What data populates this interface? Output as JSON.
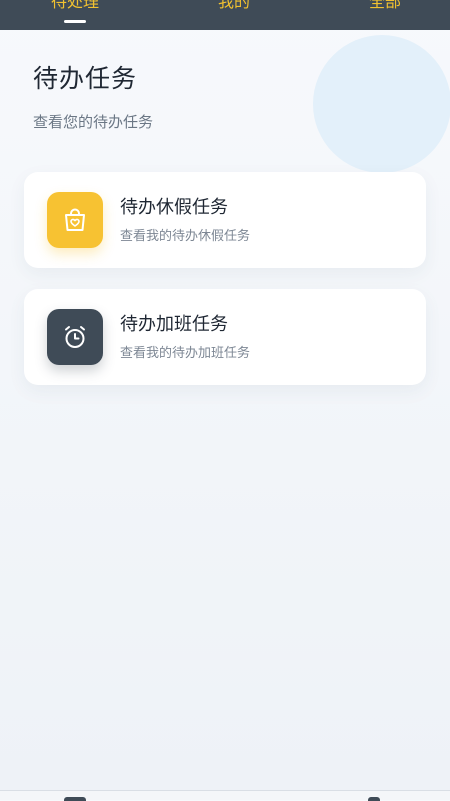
{
  "tabs": [
    {
      "label": "待处理",
      "active": true
    },
    {
      "label": "我的",
      "active": false
    },
    {
      "label": "全部",
      "active": false
    }
  ],
  "header": {
    "title": "待办任务",
    "subtitle": "查看您的待办任务"
  },
  "cards": [
    {
      "title": "待办休假任务",
      "desc": "查看我的待办休假任务",
      "icon": "shopping-bag-heart-icon",
      "color": "#f7c232"
    },
    {
      "title": "待办加班任务",
      "desc": "查看我的待办加班任务",
      "icon": "alarm-clock-icon",
      "color": "#3f4b57"
    }
  ],
  "colors": {
    "topbar": "#3f4b57",
    "tab_text": "#f2c230",
    "accent_yellow": "#f7c232",
    "accent_dark": "#3f4b57"
  }
}
